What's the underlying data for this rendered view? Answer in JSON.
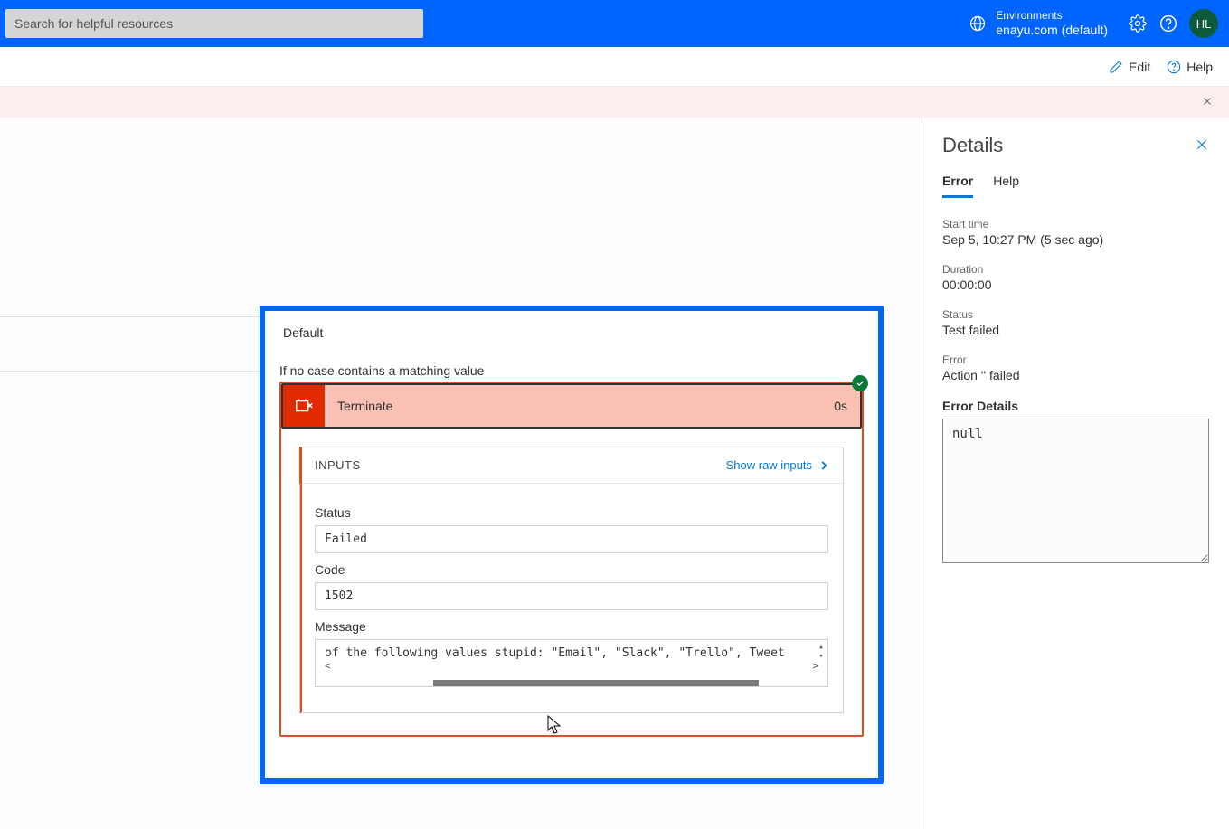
{
  "header": {
    "searchPlaceholder": "Search for helpful resources",
    "envLabel": "Environments",
    "envValue": "enayu.com (default)",
    "avatar": "HL"
  },
  "toolbar": {
    "edit": "Edit",
    "help": "Help"
  },
  "card": {
    "title": "Default",
    "subtitle": "If no case contains a matching value",
    "terminate": {
      "label": "Terminate",
      "duration": "0s"
    },
    "inputs": {
      "heading": "INPUTS",
      "rawLink": "Show raw inputs",
      "statusLabel": "Status",
      "statusValue": "Failed",
      "codeLabel": "Code",
      "codeValue": "1502",
      "messageLabel": "Message",
      "messageValue": "of the following values stupid: \"Email\", \"Slack\", \"Trello\", Tweet"
    }
  },
  "details": {
    "title": "Details",
    "tabs": {
      "error": "Error",
      "help": "Help"
    },
    "startLabel": "Start time",
    "startValue": "Sep 5, 10:27 PM (5 sec ago)",
    "durationLabel": "Duration",
    "durationValue": "00:00:00",
    "statusLabel": "Status",
    "statusValue": "Test failed",
    "errorLabel": "Error",
    "errorValue": "Action '' failed",
    "errorDetailsLabel": "Error Details",
    "errorDetailsValue": "null"
  }
}
